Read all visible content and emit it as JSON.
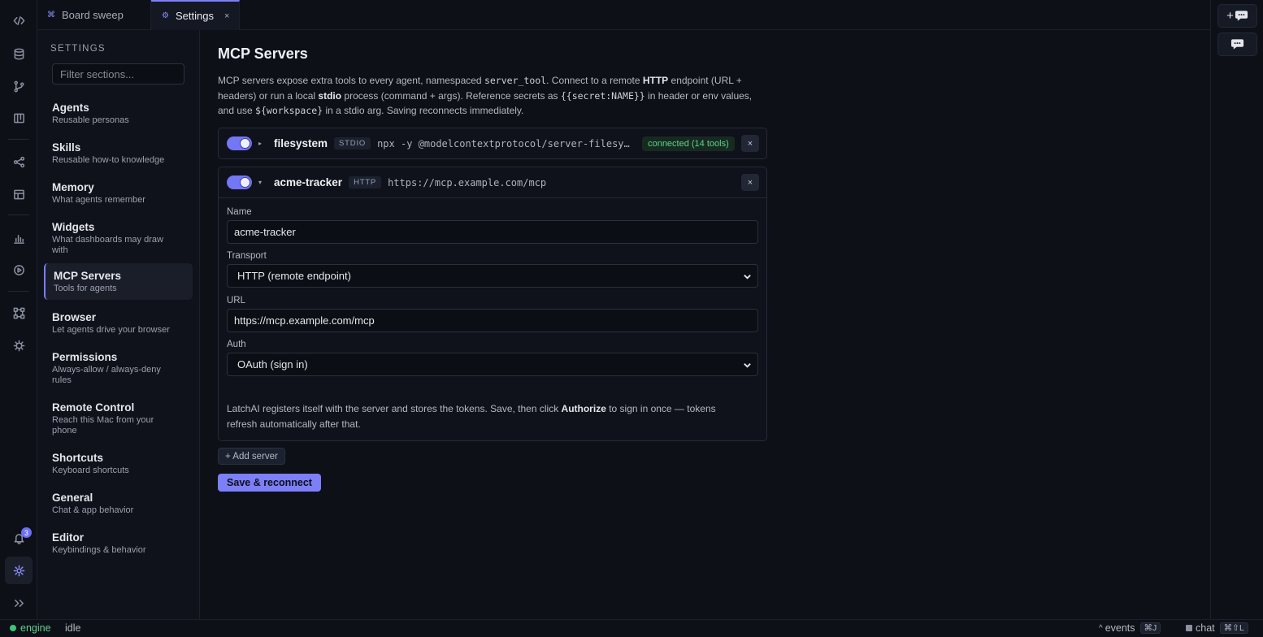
{
  "tabs": [
    {
      "icon": "⌘",
      "label": "Board sweep"
    },
    {
      "icon": "⚙",
      "label": "Settings",
      "close": "×"
    }
  ],
  "rail": {
    "notification_count": "3"
  },
  "settings_nav": {
    "heading": "SETTINGS",
    "filter_placeholder": "Filter sections...",
    "items": [
      {
        "title": "Agents",
        "desc": "Reusable personas"
      },
      {
        "title": "Skills",
        "desc": "Reusable how-to knowledge"
      },
      {
        "title": "Memory",
        "desc": "What agents remember"
      },
      {
        "title": "Widgets",
        "desc": "What dashboards may draw with"
      },
      {
        "title": "MCP Servers",
        "desc": "Tools for agents"
      },
      {
        "title": "Browser",
        "desc": "Let agents drive your browser"
      },
      {
        "title": "Permissions",
        "desc": "Always-allow / always-deny rules"
      },
      {
        "title": "Remote Control",
        "desc": "Reach this Mac from your phone"
      },
      {
        "title": "Shortcuts",
        "desc": "Keyboard shortcuts"
      },
      {
        "title": "General",
        "desc": "Chat & app behavior"
      },
      {
        "title": "Editor",
        "desc": "Keybindings & behavior"
      }
    ]
  },
  "page": {
    "title": "MCP Servers",
    "desc_1": "MCP servers expose extra tools to every agent, namespaced ",
    "desc_code_1": "server_tool",
    "desc_2": ". Connect to a remote ",
    "desc_b_1": "HTTP",
    "desc_3": " endpoint (URL + headers) or run a local ",
    "desc_b_2": "stdio",
    "desc_4": " process (command + args). Reference secrets as ",
    "desc_code_2": "{{secret:NAME}}",
    "desc_5": " in header or env values, and use ",
    "desc_code_3": "${workspace}",
    "desc_6": " in a stdio arg. Saving reconnects immediately."
  },
  "servers": [
    {
      "name": "filesystem",
      "transport_tag": "STDIO",
      "command": "npx -y @modelcontextprotocol/server-filesystem",
      "status": "connected (14 tools)",
      "enabled": true,
      "caret": "▸",
      "remove": "×"
    },
    {
      "name": "acme-tracker",
      "transport_tag": "HTTP",
      "command": "https://mcp.example.com/mcp",
      "enabled": true,
      "caret": "▾",
      "remove": "×",
      "form": {
        "name_label": "Name",
        "name_value": "acme-tracker",
        "transport_label": "Transport",
        "transport_value": "HTTP (remote endpoint)",
        "url_label": "URL",
        "url_value": "https://mcp.example.com/mcp",
        "auth_label": "Auth",
        "auth_value": "OAuth (sign in)",
        "note_1": "LatchAI registers itself with the server and stores the tokens. Save, then click ",
        "note_b": "Authorize",
        "note_2": " to sign in once — tokens refresh automatically after that."
      }
    }
  ],
  "actions": {
    "add_server": "+ Add server",
    "save": "Save & reconnect"
  },
  "statusbar": {
    "engine": "engine",
    "state": "idle",
    "events": "events",
    "events_kbd": "⌘J",
    "chat": "chat",
    "chat_kbd": "⌘⇧L"
  },
  "colors": {
    "accent": "#7c7ff7",
    "connected": "#5fd18e",
    "engine_dot": "#3cc47c"
  }
}
